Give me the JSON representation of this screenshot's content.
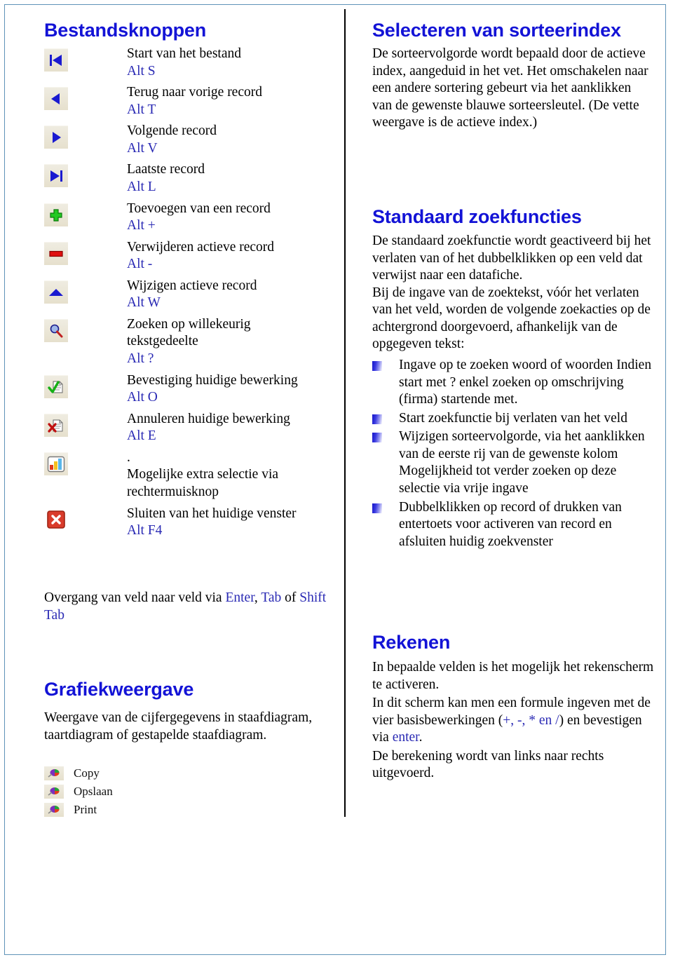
{
  "document": {
    "title": "Bestandsknoppen",
    "colors": {
      "heading_blue": "#1313d6",
      "key_blue": "#2a2ab4",
      "border": "#5f93b8",
      "divider": "#000000"
    }
  },
  "left": {
    "heading": "Bestandsknoppen",
    "buttons": [
      {
        "icon": "first-record-icon",
        "label": "Start van het bestand",
        "shortcut": "Alt S"
      },
      {
        "icon": "previous-record-icon",
        "label": "Terug naar vorige record",
        "shortcut": "Alt T"
      },
      {
        "icon": "next-record-icon",
        "label": "Volgende record",
        "shortcut": "Alt V"
      },
      {
        "icon": "last-record-icon",
        "label": "Laatste record",
        "shortcut": "Alt L"
      },
      {
        "icon": "add-record-icon",
        "label": "Toevoegen van een record",
        "shortcut": "Alt +"
      },
      {
        "icon": "delete-record-icon",
        "label": "Verwijderen actieve record",
        "shortcut": "Alt -"
      },
      {
        "icon": "edit-record-icon",
        "label": "Wijzigen actieve record",
        "shortcut": "Alt W"
      },
      {
        "icon": "search-icon",
        "label": "Zoeken op willekeurig",
        "label2": "tekstgedeelte",
        "shortcut": "Alt ?"
      },
      {
        "icon": "confirm-icon",
        "label": "Bevestiging huidige bewerking",
        "shortcut": "Alt O"
      },
      {
        "icon": "cancel-icon",
        "label": "Annuleren huidige bewerking",
        "shortcut": "Alt E"
      },
      {
        "icon": "chart-icon",
        "label": ".",
        "label2": "Mogelijke extra selectie via",
        "label3": "rechtermuisknop",
        "shortcut": ""
      },
      {
        "icon": "close-window-icon",
        "label": "Sluiten van het huidige venster",
        "shortcut": "Alt F4"
      }
    ],
    "overgang": {
      "prefix": "Overgang van veld naar veld via ",
      "key1": "Enter",
      "sep1": ", ",
      "key2": "Tab",
      "mid": " of ",
      "key3": "Shift Tab"
    },
    "grafiek": {
      "heading": "Grafiekweergave",
      "body": "Weergave van de cijfergegevens in staafdiagram, taartdiagram of gestapelde staafdiagram.",
      "items": [
        {
          "icon": "palette-icon",
          "label": "Copy"
        },
        {
          "icon": "palette-icon",
          "label": "Opslaan"
        },
        {
          "icon": "palette-icon",
          "label": "Print"
        }
      ]
    }
  },
  "right": {
    "sorteerindex": {
      "heading": "Selecteren van sorteerindex",
      "body": "De sorteervolgorde wordt bepaald door de actieve index, aangeduid in het vet. Het omschakelen naar een andere sortering gebeurt via het aanklikken van de gewenste blauwe sorteersleutel. (De vette weergave is de actieve index.)"
    },
    "zoekfuncties": {
      "heading": "Standaard zoekfuncties",
      "body_p1": "De standaard zoekfunctie wordt geactiveerd bij het verlaten van of het dubbelklikken op een veld dat verwijst naar een datafiche.",
      "body_p2": "Bij de ingave van de zoektekst, vóór het verlaten van het veld, worden de volgende zoekacties op de achtergrond doorgevoerd, afhankelijk van de opgegeven tekst:",
      "bullets": [
        "Ingave op te zoeken woord of woorden Indien start met ? enkel zoeken op omschrijving (firma) startende met.",
        "Start zoekfunctie bij verlaten van het veld",
        "Wijzigen sorteervolgorde, via  het aanklikken van de eerste rij van de gewenste kolom Mogelijkheid tot verder zoeken op deze selectie via vrije ingave",
        "Dubbelklikken op record of drukken van entertoets voor activeren van record en afsluiten huidig zoekvenster"
      ]
    },
    "rekenen": {
      "heading": "Rekenen",
      "p1": "In bepaalde velden is het mogelijk het rekenscherm te activeren.",
      "p2_a": "In dit scherm kan men een formule ingeven met de vier basisbewerkingen (",
      "p2_ops": "+, -, * en /",
      "p2_b": ") en bevestigen via ",
      "p2_key": "enter",
      "p2_c": ".",
      "p3": "De berekening wordt van links naar rechts uitgevoerd."
    }
  }
}
